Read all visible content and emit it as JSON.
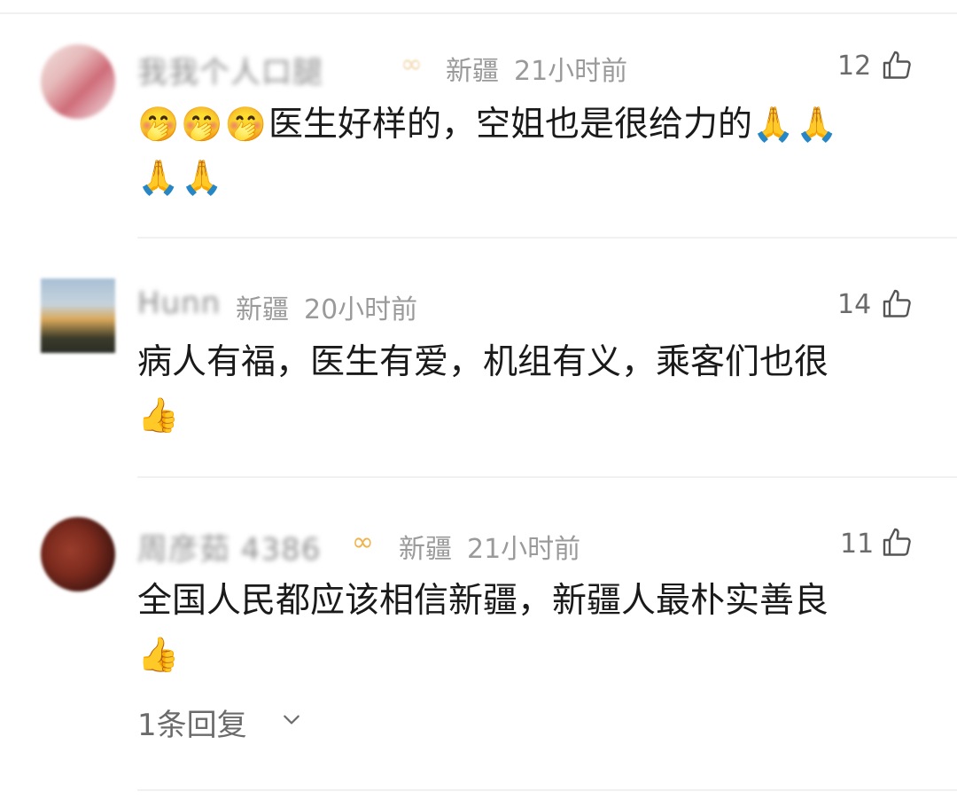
{
  "comments": [
    {
      "username": "我我个人口腿",
      "badge": "∞",
      "location": "新疆",
      "time": "21小时前",
      "likes": "12",
      "lead_emojis": [
        "🤭",
        "🤭",
        "🤭"
      ],
      "text": "医生好样的，空姐也是很给力的",
      "trail_emojis_line1": [
        "🙏",
        "🙏"
      ],
      "trail_emojis_line2": [
        "🙏",
        "🙏"
      ]
    },
    {
      "username": "Hunn",
      "location": "新疆",
      "time": "20小时前",
      "likes": "14",
      "text": "病人有福，医生有爱，机组有义，乘客们也很",
      "trail_emojis_line2": [
        "👍"
      ]
    },
    {
      "username": "周彦茹 4386",
      "badge": "∞",
      "location": "新疆",
      "time": "21小时前",
      "likes": "11",
      "text": "全国人民都应该相信新疆，新疆人最朴实善良",
      "trail_emojis_line2": [
        "👍"
      ],
      "replies_label": "1条回复"
    }
  ],
  "colors": {
    "text": "#1a1a1a",
    "meta": "#9a9a9a",
    "divider": "#f1f1f1",
    "vip_badge": "#f0b24a"
  },
  "icons": {
    "like": "thumbs-up-outline-icon",
    "expand": "chevron-down-icon"
  }
}
